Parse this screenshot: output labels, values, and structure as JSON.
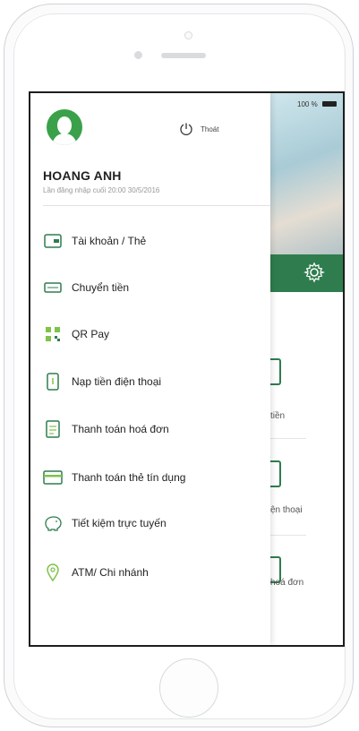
{
  "status_bar": {
    "battery_text": "100 %"
  },
  "drawer": {
    "logout_label": "Thoát",
    "user_name": "HOANG ANH",
    "last_login": "Lần đăng nhập cuối 20:00 30/5/2016",
    "menu": [
      {
        "label": "Tài khoản / Thẻ",
        "icon": "account-card-icon"
      },
      {
        "label": "Chuyển tiền",
        "icon": "transfer-icon"
      },
      {
        "label": "QR Pay",
        "icon": "qr-icon"
      },
      {
        "label": "Nạp tiền điện thoại",
        "icon": "phone-topup-icon"
      },
      {
        "label": "Thanh toán hoá đơn",
        "icon": "bill-icon"
      },
      {
        "label": "Thanh toán thẻ tín dụng",
        "icon": "credit-card-icon"
      },
      {
        "label": "Tiết kiệm trực tuyến",
        "icon": "piggy-bank-icon"
      },
      {
        "label": "ATM/ Chi nhánh",
        "icon": "location-pin-icon"
      }
    ]
  },
  "background_app": {
    "labels": [
      "tiền",
      "ện thoại",
      "hoá đơn"
    ]
  },
  "colors": {
    "accent": "#2f7d4e",
    "avatar": "#3aa14a",
    "text": "#222222"
  }
}
